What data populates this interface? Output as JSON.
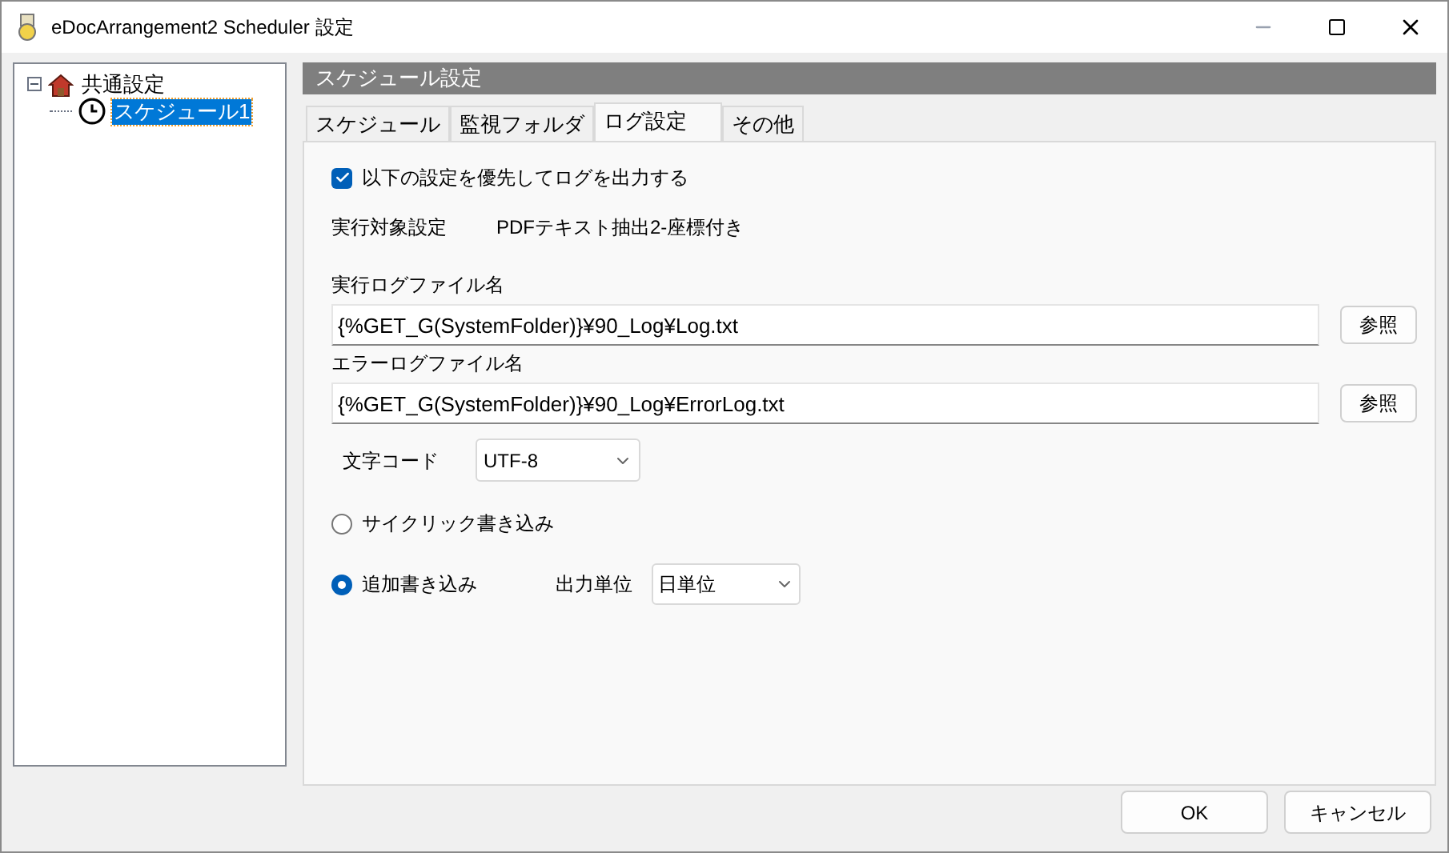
{
  "window": {
    "title": "eDocArrangement2 Scheduler 設定"
  },
  "tree": [
    {
      "label": "共通設定",
      "kind": "house",
      "expanded": true,
      "selected": false,
      "children": [
        {
          "label": "スケジュール1",
          "kind": "clock",
          "selected": true
        }
      ]
    }
  ],
  "panel": {
    "header": "スケジュール設定"
  },
  "tabs": [
    {
      "label": "スケジュール",
      "selected": false
    },
    {
      "label": "監視フォルダ",
      "selected": false
    },
    {
      "label": "ログ設定",
      "selected": true
    },
    {
      "label": "その他",
      "selected": false
    }
  ],
  "priority": {
    "label": "以下の設定を優先してログを出力する",
    "checked": true
  },
  "target": {
    "label": "実行対象設定",
    "value": "PDFテキスト抽出2-座標付き"
  },
  "files": [
    {
      "label": "実行ログファイル名",
      "value": "{%GET_G(SystemFolder)}¥90_Log¥Log.txt",
      "button": "参照"
    },
    {
      "label": "エラーログファイル名",
      "value": "{%GET_G(SystemFolder)}¥90_Log¥ErrorLog.txt",
      "button": "参照"
    }
  ],
  "encoding": {
    "label": "文字コード",
    "value": "UTF-8"
  },
  "modes": [
    {
      "label": "サイクリック書き込み",
      "selected": false
    },
    {
      "label": "追加書き込み",
      "selected": true,
      "unit_label": "出力単位",
      "unit_value": "日単位"
    }
  ],
  "buttons": [
    "OK",
    "キャンセル"
  ]
}
